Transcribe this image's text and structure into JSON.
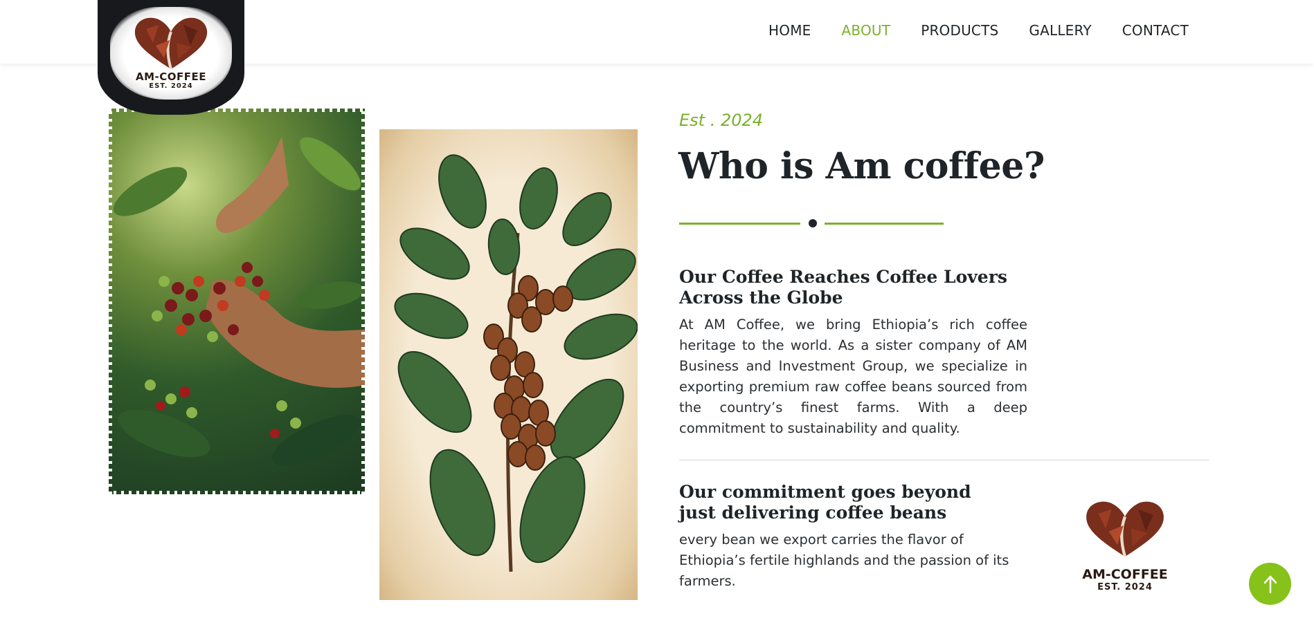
{
  "header": {
    "logo": {
      "name": "AM-COFFEE",
      "sub": "EST. 2024"
    },
    "nav": [
      {
        "label": "HOME",
        "active": false
      },
      {
        "label": "ABOUT",
        "active": true
      },
      {
        "label": "PRODUCTS",
        "active": false
      },
      {
        "label": "GALLERY",
        "active": false
      },
      {
        "label": "CONTACT",
        "active": false
      }
    ]
  },
  "about": {
    "est": "Est . 2024",
    "title": "Who is Am coffee?",
    "section1": {
      "heading": "Our Coffee Reaches Coffee Lovers Across the Globe",
      "text": "At AM Coffee, we bring Ethiopia’s rich coffee heritage to the world. As a sister company of AM Business and Investment Group, we specialize in exporting premium raw coffee beans sourced from the country’s finest farms. With a deep commitment to sustainability and quality."
    },
    "section2": {
      "heading": "Our commitment goes beyond just delivering coffee beans",
      "text": "every bean we export carries the flavor of Ethiopia’s fertile highlands and the passion of its farmers."
    },
    "logo": {
      "name": "AM-COFFEE",
      "sub": "EST. 2024"
    }
  },
  "colors": {
    "accent": "#7bb02c",
    "dark": "#1f2428",
    "button": "#86c21a"
  },
  "icons": {
    "scroll_top": "arrow-up-icon"
  }
}
